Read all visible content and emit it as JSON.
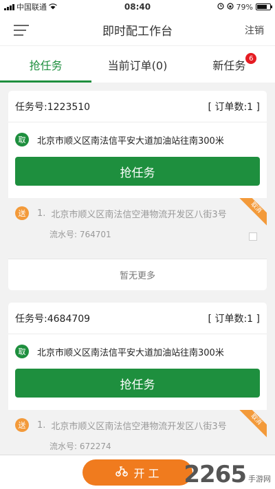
{
  "statusbar": {
    "carrier": "中国联通",
    "time": "08:40",
    "battery": "79%",
    "battery_level": 0.79
  },
  "header": {
    "title": "即时配工作台",
    "logout": "注销"
  },
  "tabs": [
    {
      "label": "抢任务"
    },
    {
      "label": "当前订单(0)"
    },
    {
      "label": "新任务",
      "badge": "6"
    }
  ],
  "tasks": [
    {
      "task_no": "任务号:1223510",
      "order_count": "[ 订单数:1 ]",
      "pickup_tag": "取",
      "pickup_address": "北京市顺义区南法信平安大道加油站往南300米",
      "grab_label": "抢任务",
      "deliveries": [
        {
          "tag": "送",
          "index": "1.",
          "address": "北京市顺义区南法信空港物流开发区八街3号",
          "serial": "流水号: 764701",
          "ribbon": "取消"
        }
      ],
      "no_more": "暂无更多"
    },
    {
      "task_no": "任务号:4684709",
      "order_count": "[ 订单数:1 ]",
      "pickup_tag": "取",
      "pickup_address": "北京市顺义区南法信平安大道加油站往南300米",
      "grab_label": "抢任务",
      "deliveries": [
        {
          "tag": "送",
          "index": "1.",
          "address": "北京市顺义区南法信空港物流开发区八街3号",
          "serial": "流水号: 672274",
          "ribbon": "取消"
        }
      ]
    }
  ],
  "bottom": {
    "start_label": "开 工"
  },
  "watermark": {
    "brand": "2265",
    "site": "手游网"
  },
  "colors": {
    "primary_green": "#1e8f3e",
    "accent_orange": "#f07b1e",
    "badge_red": "#e51c23"
  }
}
